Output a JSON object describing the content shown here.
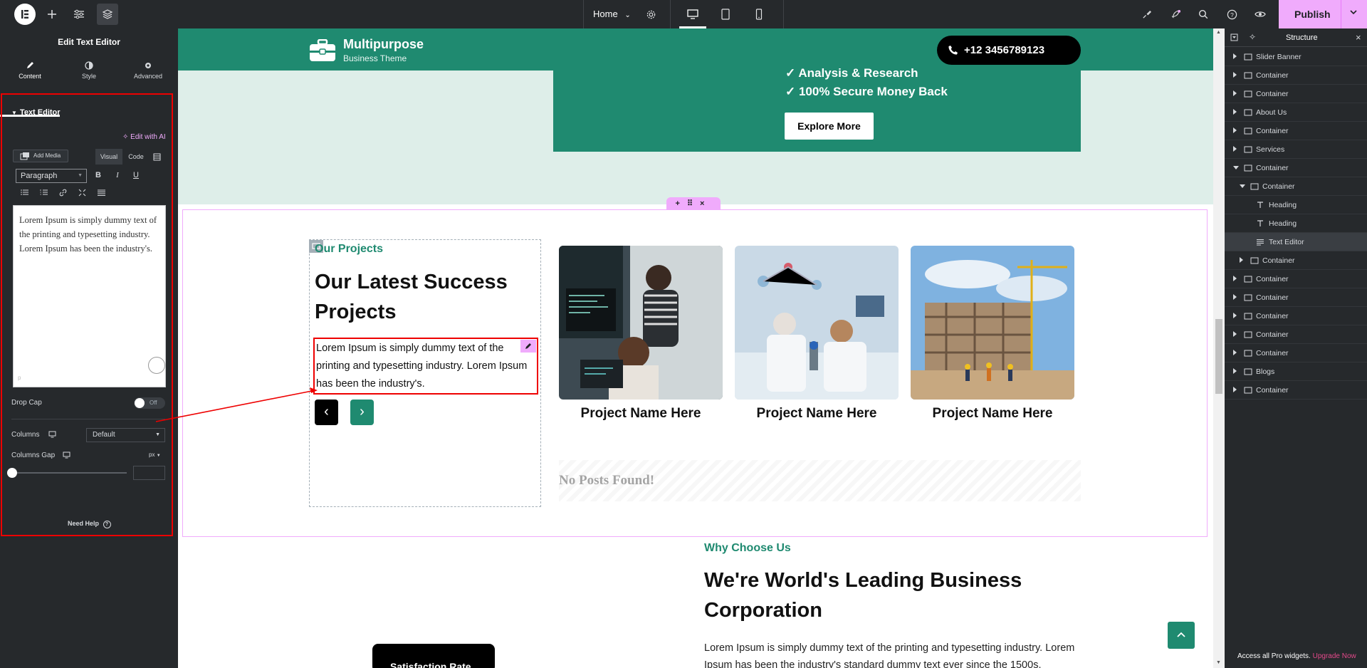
{
  "topbar": {
    "page_name": "Home",
    "publish_label": "Publish"
  },
  "left_panel": {
    "title": "Edit Text Editor",
    "tabs": [
      {
        "label": "Content",
        "icon": "pencil-icon"
      },
      {
        "label": "Style",
        "icon": "half-circle-icon"
      },
      {
        "label": "Advanced",
        "icon": "gear-icon"
      }
    ],
    "section_title": "Text Editor",
    "edit_with_ai": "Edit with AI",
    "add_media": "Add Media",
    "visual_tab": "Visual",
    "code_tab": "Code",
    "format_select": "Paragraph",
    "bold": "B",
    "italic": "I",
    "underline": "U",
    "editor_text": "Lorem Ipsum is simply dummy text of the printing and typesetting industry. Lorem Ipsum has been the industry's.",
    "editor_footer": "p",
    "drop_cap_label": "Drop Cap",
    "drop_cap_value": "Off",
    "columns_label": "Columns",
    "columns_value": "Default",
    "columns_gap_label": "Columns Gap",
    "columns_gap_unit": "px",
    "need_help": "Need Help"
  },
  "canvas": {
    "brand_name": "Multipurpose",
    "brand_sub": "Business Theme",
    "phone": "+12 3456789123",
    "checks": [
      "✓ Analysis & Research",
      "✓ 100% Secure Money Back"
    ],
    "explore_label": "Explore More",
    "eyebrow": "Our Projects",
    "heading_line1": "Our Latest Success",
    "heading_line2": "Projects",
    "text_editor_text": "Lorem Ipsum is simply dummy text of the printing and typesetting industry. Lorem Ipsum has been the industry's.",
    "projects": [
      "Project Name Here",
      "Project Name Here",
      "Project Name Here"
    ],
    "no_posts": "No Posts Found!",
    "why_eyebrow": "Why Choose Us",
    "why_heading_line1": "We're World's Leading Business",
    "why_heading_line2": "Corporation",
    "why_para": "Lorem Ipsum is simply dummy text of the printing and typesetting industry. Lorem Ipsum has been the industry's standard dummy text ever since the 1500s.",
    "black_btn": "Satisfaction Rate"
  },
  "structure": {
    "title": "Structure",
    "items": [
      {
        "label": "Slider Banner",
        "level": 0,
        "caret": "right",
        "icon": "container-icon"
      },
      {
        "label": "Container",
        "level": 0,
        "caret": "right",
        "icon": "container-icon"
      },
      {
        "label": "Container",
        "level": 0,
        "caret": "right",
        "icon": "container-icon"
      },
      {
        "label": "About Us",
        "level": 0,
        "caret": "right",
        "icon": "container-icon"
      },
      {
        "label": "Container",
        "level": 0,
        "caret": "right",
        "icon": "container-icon"
      },
      {
        "label": "Services",
        "level": 0,
        "caret": "right",
        "icon": "container-icon"
      },
      {
        "label": "Container",
        "level": 0,
        "caret": "down",
        "icon": "container-icon"
      },
      {
        "label": "Container",
        "level": 1,
        "caret": "down",
        "icon": "container-icon"
      },
      {
        "label": "Heading",
        "level": 2,
        "caret": "none",
        "icon": "heading-icon"
      },
      {
        "label": "Heading",
        "level": 2,
        "caret": "none",
        "icon": "heading-icon"
      },
      {
        "label": "Text Editor",
        "level": 2,
        "caret": "none",
        "icon": "text-editor-icon"
      },
      {
        "label": "Container",
        "level": 1,
        "caret": "right",
        "icon": "container-icon"
      },
      {
        "label": "Container",
        "level": 0,
        "caret": "right",
        "icon": "container-icon"
      },
      {
        "label": "Container",
        "level": 0,
        "caret": "right",
        "icon": "container-icon"
      },
      {
        "label": "Container",
        "level": 0,
        "caret": "right",
        "icon": "container-icon"
      },
      {
        "label": "Container",
        "level": 0,
        "caret": "right",
        "icon": "container-icon"
      },
      {
        "label": "Container",
        "level": 0,
        "caret": "right",
        "icon": "container-icon"
      },
      {
        "label": "Blogs",
        "level": 0,
        "caret": "right",
        "icon": "container-icon"
      },
      {
        "label": "Container",
        "level": 0,
        "caret": "right",
        "icon": "container-icon"
      }
    ],
    "selected_index": 10,
    "footer_text": "Access all Pro widgets.",
    "footer_link": "Upgrade Now"
  }
}
